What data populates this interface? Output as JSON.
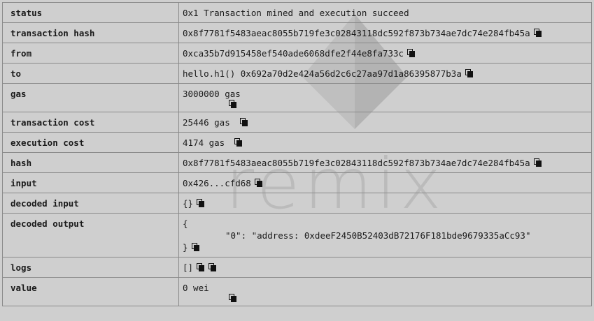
{
  "watermark": {
    "text": "remix"
  },
  "rows": {
    "status": {
      "label": "status",
      "value": "0x1 Transaction mined and execution succeed"
    },
    "transaction_hash": {
      "label": "transaction hash",
      "value": "0x8f7781f5483aeac8055b719fe3c02843118dc592f873b734ae7dc74e284fb45a"
    },
    "from": {
      "label": "from",
      "value": "0xca35b7d915458ef540ade6068dfe2f44e8fa733c"
    },
    "to": {
      "label": "to",
      "value": "hello.h1() 0x692a70d2e424a56d2c6c27aa97d1a86395877b3a"
    },
    "gas": {
      "label": "gas",
      "value": "3000000 gas"
    },
    "transaction_cost": {
      "label": "transaction cost",
      "value": "25446 gas"
    },
    "execution_cost": {
      "label": "execution cost",
      "value": "4174 gas"
    },
    "hash": {
      "label": "hash",
      "value": "0x8f7781f5483aeac8055b719fe3c02843118dc592f873b734ae7dc74e284fb45a"
    },
    "input": {
      "label": "input",
      "value": "0x426...cfd68"
    },
    "decoded_input": {
      "label": "decoded input",
      "value": "{}"
    },
    "decoded_output": {
      "label": "decoded output",
      "open": "{",
      "entry": "\"0\": \"address: 0xdeeF2450B52403dB72176F181bde9679335aCc93\"",
      "close": "}"
    },
    "logs": {
      "label": "logs",
      "value": "[]"
    },
    "value": {
      "label": "value",
      "value": "0 wei"
    }
  },
  "icons": {
    "copy": "copy-icon"
  }
}
